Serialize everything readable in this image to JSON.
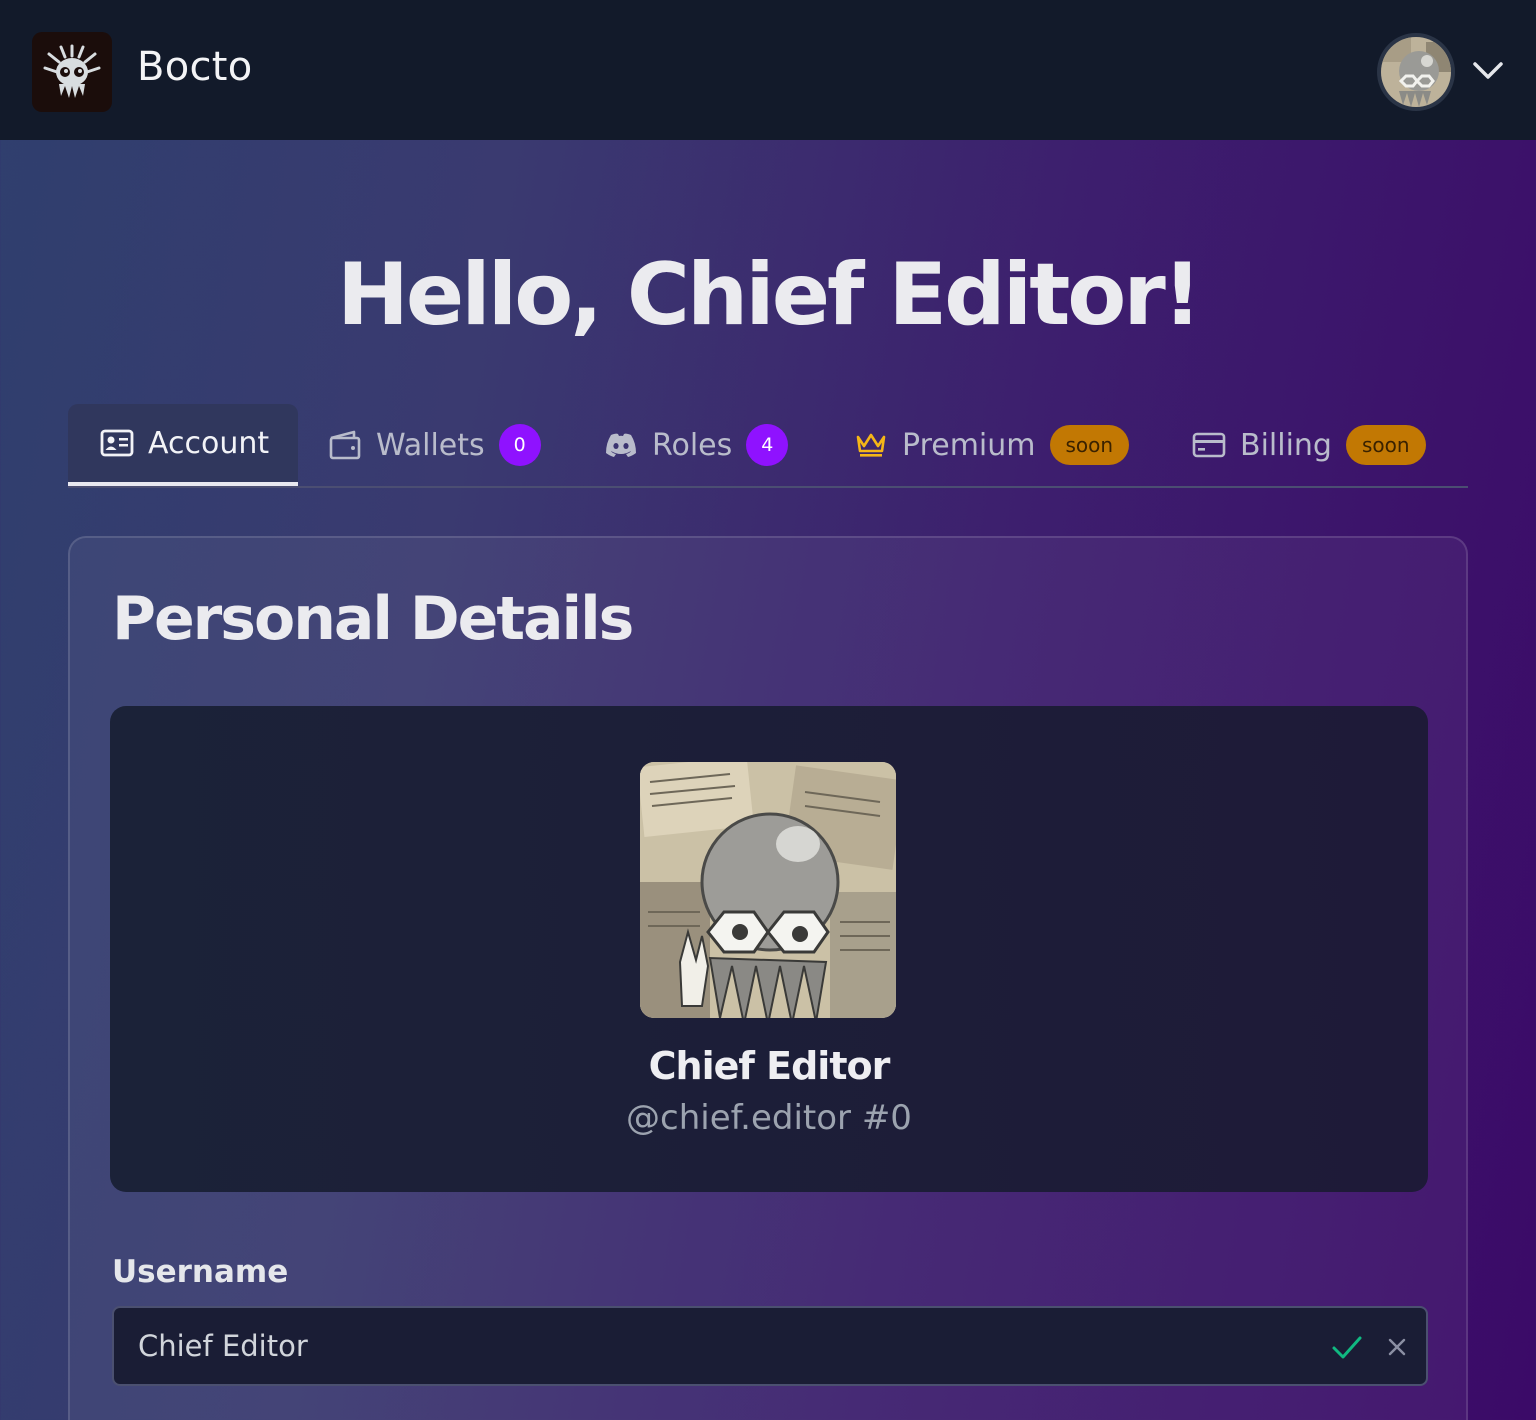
{
  "navbar": {
    "brand": "Bocto",
    "logo_icon": "octopus-logo-icon",
    "avatar_icon": "user-avatar",
    "menu_icon": "chevron-down-icon"
  },
  "greeting": "Hello, Chief Editor!",
  "tabs": [
    {
      "label": "Account",
      "icon": "id-card-icon",
      "active": true
    },
    {
      "label": "Wallets",
      "icon": "wallet-icon",
      "badge": "0"
    },
    {
      "label": "Roles",
      "icon": "discord-icon",
      "badge": "4"
    },
    {
      "label": "Premium",
      "icon": "crown-icon",
      "badge": "soon"
    },
    {
      "label": "Billing",
      "icon": "credit-card-icon",
      "badge": "soon"
    }
  ],
  "personal": {
    "title": "Personal Details",
    "display_name": "Chief Editor",
    "handle": "@chief.editor #0",
    "username_label": "Username",
    "username_value": "Chief Editor"
  },
  "colors": {
    "navbar_bg": "#121a2a",
    "badge_purple": "#8f12ff",
    "badge_soon": "#c27803",
    "confirm_green": "#10b981"
  }
}
